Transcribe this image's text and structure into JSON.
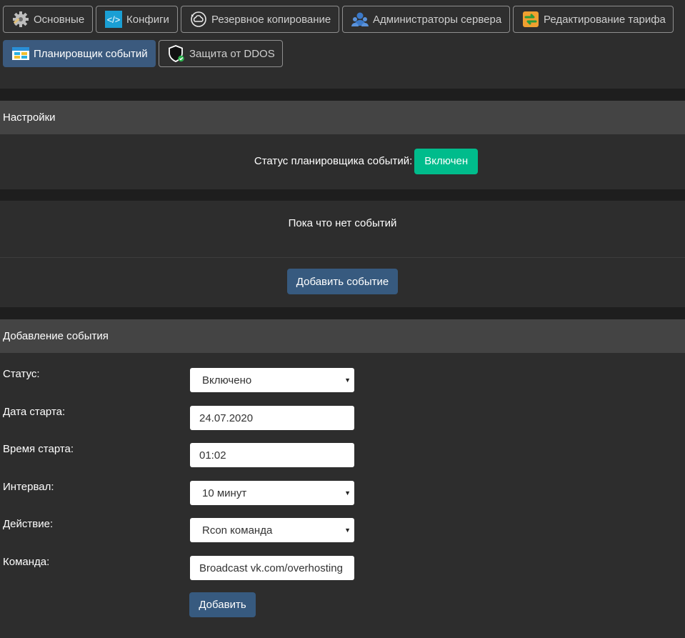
{
  "tabs": [
    {
      "id": "basic",
      "label": "Основные",
      "icon": "gear-icon",
      "active": false
    },
    {
      "id": "configs",
      "label": "Конфиги",
      "icon": "code-icon",
      "active": false
    },
    {
      "id": "backup",
      "label": "Резервное копирование",
      "icon": "cloud-backup-icon",
      "active": false
    },
    {
      "id": "admins",
      "label": "Администраторы сервера",
      "icon": "users-icon",
      "active": false
    },
    {
      "id": "tariff",
      "label": "Редактирование тарифа",
      "icon": "exchange-icon",
      "active": false
    },
    {
      "id": "scheduler",
      "label": "Планировщик событий",
      "icon": "scheduler-icon",
      "active": true
    },
    {
      "id": "ddos",
      "label": "Защита от DDOS",
      "icon": "shield-icon",
      "active": false
    }
  ],
  "settings": {
    "title": "Настройки",
    "status_label": "Статус планировщика событий:",
    "status_value": "Включен"
  },
  "events": {
    "empty_text": "Пока что нет событий",
    "add_button": "Добавить событие"
  },
  "add_event": {
    "title": "Добавление события",
    "fields": {
      "status": {
        "label": "Статус:",
        "value": "Включено"
      },
      "start_date": {
        "label": "Дата старта:",
        "value": "24.07.2020"
      },
      "start_time": {
        "label": "Время старта:",
        "value": "01:02"
      },
      "interval": {
        "label": "Интервал:",
        "value": "10 минут"
      },
      "action": {
        "label": "Действие:",
        "value": "Rcon команда"
      },
      "command": {
        "label": "Команда:",
        "value": "Broadcast vk.com/overhosting"
      }
    },
    "submit_button": "Добавить"
  },
  "colors": {
    "background": "#2d2d2d",
    "panel_header": "#444444",
    "primary": "#375a7f",
    "success": "#00bc8c"
  }
}
